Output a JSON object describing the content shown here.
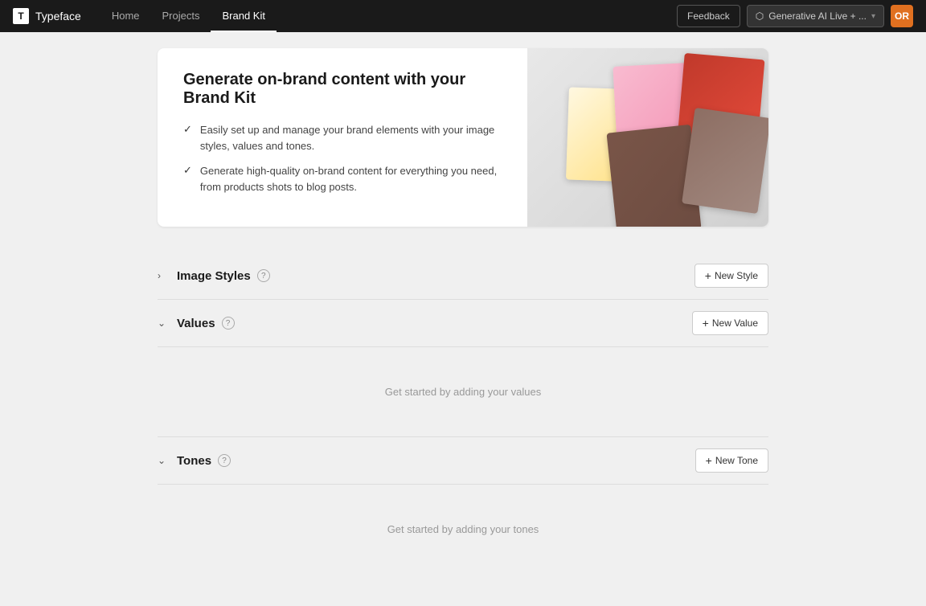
{
  "nav": {
    "logo_icon": "T",
    "logo_text": "Typeface",
    "links": [
      {
        "label": "Home",
        "active": false
      },
      {
        "label": "Projects",
        "active": false
      },
      {
        "label": "Brand Kit",
        "active": true
      }
    ],
    "feedback_label": "Feedback",
    "gen_ai_label": "Generative AI Live + ...",
    "avatar_initials": "OR"
  },
  "hero": {
    "title": "Generate on-brand content with your Brand Kit",
    "items": [
      "Easily set up and manage your brand elements with your image styles, values and tones.",
      "Generate high-quality on-brand content for everything you need, from products shots to blog posts."
    ]
  },
  "sections": {
    "image_styles": {
      "title": "Image Styles",
      "expanded": false,
      "action_label": "New Style",
      "empty_text": ""
    },
    "values": {
      "title": "Values",
      "expanded": true,
      "action_label": "New Value",
      "empty_text": "Get started by adding your values"
    },
    "tones": {
      "title": "Tones",
      "expanded": true,
      "action_label": "New Tone",
      "empty_text": "Get started by adding your tones"
    }
  }
}
